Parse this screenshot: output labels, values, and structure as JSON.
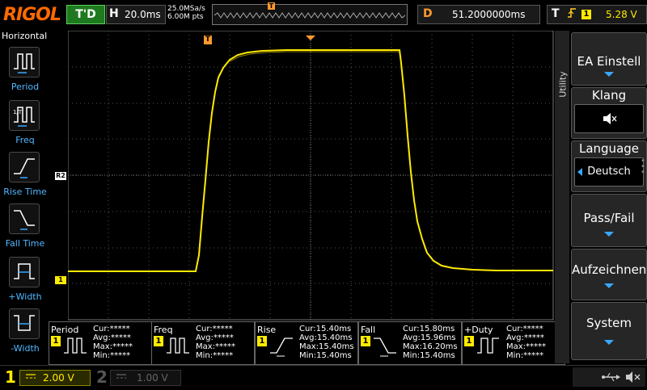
{
  "topbar": {
    "brand": "RIGOL",
    "run_state": "T'D",
    "timebase_label": "H",
    "timebase_value": "20.0ms",
    "sample_rate": "25.0MSa/s",
    "memory_depth": "6.00M pts",
    "trigger_marker": "T",
    "delay_label": "D",
    "delay_value": "51.2000000ms",
    "trigger_label": "T",
    "trigger_source": "1",
    "trigger_level": "5.28 V"
  },
  "left_panel": {
    "title": "Horizontal",
    "items": [
      {
        "label": "Period",
        "icon": "period-icon"
      },
      {
        "label": "Freq",
        "icon": "freq-icon"
      },
      {
        "label": "Rise Time",
        "icon": "rise-time-icon"
      },
      {
        "label": "Fall Time",
        "icon": "fall-time-icon"
      },
      {
        "label": "+Width",
        "icon": "plus-width-icon"
      },
      {
        "label": "-Width",
        "icon": "minus-width-icon"
      }
    ]
  },
  "waveform": {
    "trigger_pos_marker": "T",
    "ref_marker": "R2",
    "ch1_marker": "1"
  },
  "measurements": [
    {
      "name": "Period",
      "channel": "1",
      "cur": "Cur:*****",
      "avg": "Avg:*****",
      "max": "Max:*****",
      "min": "Min:*****"
    },
    {
      "name": "Freq",
      "channel": "1",
      "cur": "Cur:*****",
      "avg": "Avg:*****",
      "max": "Max:*****",
      "min": "Min:*****"
    },
    {
      "name": "Rise",
      "channel": "1",
      "cur": "Cur:15.40ms",
      "avg": "Avg:15.40ms",
      "max": "Max:15.40ms",
      "min": "Min:15.40ms"
    },
    {
      "name": "Fall",
      "channel": "1",
      "cur": "Cur:15.80ms",
      "avg": "Avg:15.96ms",
      "max": "Max:16.20ms",
      "min": "Min:15.40ms"
    },
    {
      "name": "+Duty",
      "channel": "1",
      "cur": "Cur:*****",
      "avg": "Avg:*****",
      "max": "Max:*****",
      "min": "Min:*****"
    }
  ],
  "right_menu": {
    "section": "Utility",
    "ea_einstell": "EA Einstell",
    "klang": "Klang",
    "klang_value": "🔇",
    "language": "Language",
    "language_value": "Deutsch",
    "pass_fail": "Pass/Fail",
    "aufzeichnen": "Aufzeichnen",
    "system": "System"
  },
  "bottombar": {
    "ch1_number": "1",
    "ch1_coupling": "⎓",
    "ch1_scale": "2.00 V",
    "ch2_number": "2",
    "ch2_coupling": "⎓",
    "ch2_scale": "1.00 V"
  },
  "colors": {
    "trace": "#ffeb00",
    "accent": "#ff9a30",
    "menu_label": "#4fb8ff",
    "brand": "#ff6a00"
  }
}
